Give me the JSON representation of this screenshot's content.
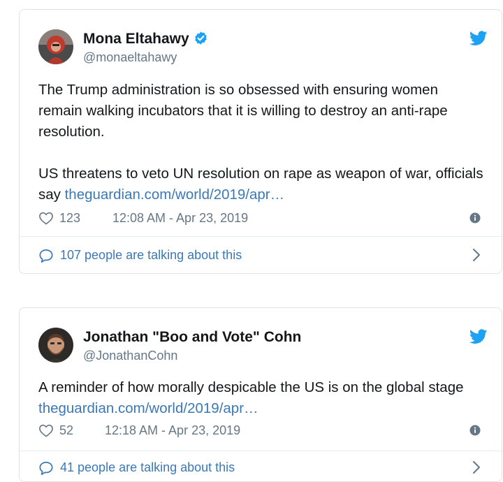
{
  "tweets": [
    {
      "name": "Mona Eltahawy",
      "handle": "@monaeltahawy",
      "verified": true,
      "paragraph1": "The Trump administration is so obsessed with ensuring women remain walking incubators that it is willing to destroy an anti-rape resolution.",
      "paragraph2_text": "US threatens to veto UN resolution on rape as weapon of war, officials say ",
      "link": "theguardian.com/world/2019/apr…",
      "likes": "123",
      "timestamp": "12:08 AM - Apr 23, 2019",
      "talking": "107 people are talking about this"
    },
    {
      "name": "Jonathan \"Boo and Vote\" Cohn",
      "handle": "@JonathanCohn",
      "verified": false,
      "text": "A reminder of how morally despicable the US is on the global stage ",
      "link": "theguardian.com/world/2019/apr…",
      "likes": "52",
      "timestamp": "12:18 AM - Apr 23, 2019",
      "talking": "41 people are talking about this"
    }
  ],
  "icons": {
    "verified": "verified-badge-icon",
    "bird": "twitter-bird-icon",
    "heart": "heart-icon",
    "info": "info-icon",
    "bubble": "speech-bubble-icon",
    "chevron": "chevron-right-icon"
  },
  "colors": {
    "link": "#3b78b5",
    "twitter_blue": "#1da1f2",
    "muted": "#657786"
  }
}
